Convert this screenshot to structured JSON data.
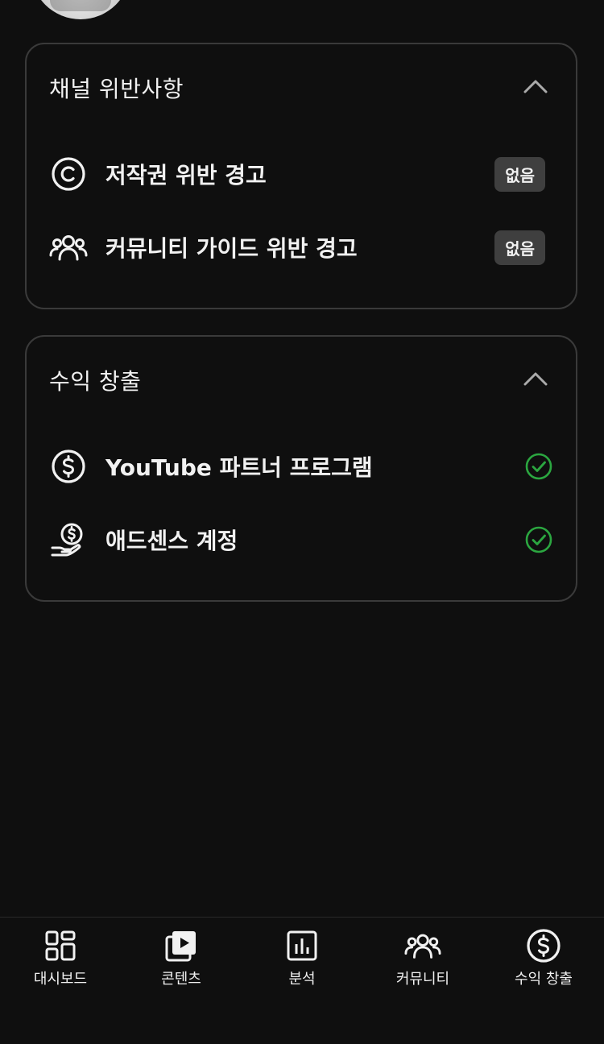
{
  "colors": {
    "background": "#0f0f0f",
    "card_border": "#3a3a3a",
    "badge_bg": "#3f3f3f",
    "check_green": "#2ba640",
    "text": "#f1f1f1"
  },
  "violations": {
    "title": "채널 위반사항",
    "collapse_icon": "chevron-up-icon",
    "items": [
      {
        "icon": "copyright-icon",
        "label": "저작권 위반 경고",
        "status": "없음"
      },
      {
        "icon": "community-icon",
        "label": "커뮤니티 가이드 위반 경고",
        "status": "없음"
      }
    ]
  },
  "monetization": {
    "title": "수익 창출",
    "collapse_icon": "chevron-up-icon",
    "items": [
      {
        "icon": "dollar-circle-icon",
        "label": "YouTube 파트너 프로그램",
        "status_icon": "check-circle-icon"
      },
      {
        "icon": "hand-dollar-icon",
        "label": "애드센스 계정",
        "status_icon": "check-circle-icon"
      }
    ]
  },
  "bottom_nav": {
    "items": [
      {
        "icon": "dashboard-icon",
        "label": "대시보드"
      },
      {
        "icon": "content-icon",
        "label": "콘텐츠"
      },
      {
        "icon": "analytics-icon",
        "label": "분석"
      },
      {
        "icon": "community-icon",
        "label": "커뮤니티"
      },
      {
        "icon": "dollar-circle-icon",
        "label": "수익 창출"
      }
    ]
  }
}
